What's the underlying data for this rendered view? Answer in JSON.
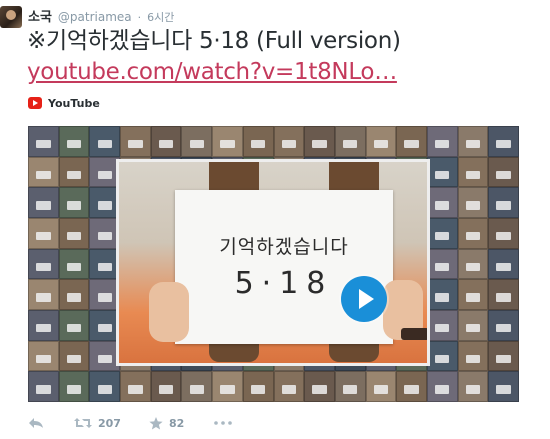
{
  "tweet": {
    "author_name": "소국",
    "handle": "@patriamea",
    "separator": "·",
    "time": "6시간",
    "text": "※기억하겠습니다 5·18 (Full version)",
    "link": "youtube.com/watch?v=1t8NLo…"
  },
  "card": {
    "source_name": "YouTube",
    "video_sign_text": "기억하겠습니다",
    "video_sign_number": "5·18"
  },
  "actions": {
    "retweets": "207",
    "favorites": "82"
  },
  "icons": [
    "avatar",
    "youtube-icon",
    "play-icon",
    "reply-icon",
    "retweet-icon",
    "favorite-icon",
    "more-icon"
  ],
  "colors": {
    "link": "#c43a5c",
    "youtube_red": "#e62117",
    "play_button": "#1a8fd8",
    "action_gray": "#aab8c2"
  }
}
